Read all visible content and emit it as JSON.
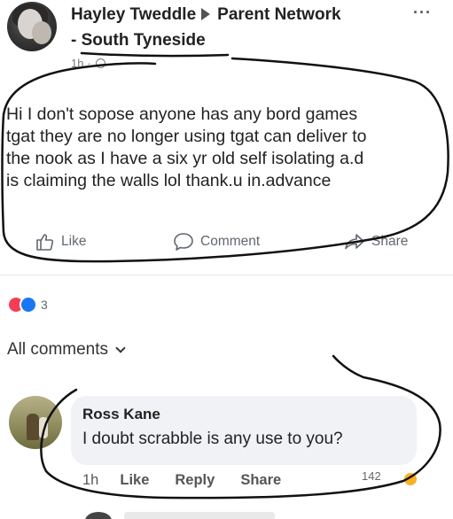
{
  "post": {
    "author": "Hayley Tweddle",
    "group": "Parent Network",
    "group_line2": "- South Tyneside",
    "time": "1h",
    "separator": "·",
    "more": "···",
    "text_lines": [
      "Hi I don't sopose anyone has any bord games",
      "tgat they are no longer using tgat can deliver to",
      "the nook as I have a six yr old self isolating a.d",
      "is claiming the walls lol  thank.u in.advance"
    ]
  },
  "actions": {
    "like": "Like",
    "comment": "Comment",
    "share": "Share"
  },
  "reactions": {
    "count": "3",
    "types": [
      "love-icon",
      "like-icon"
    ]
  },
  "comments_filter": "All comments",
  "comment": {
    "author": "Ross Kane",
    "text": "I doubt scrabble is any use to you?",
    "time": "1h",
    "like": "Like",
    "reply": "Reply",
    "share": "Share",
    "reaction_count": "142"
  },
  "colors": {
    "text": "#1c1e21",
    "muted": "#65676b",
    "like_blue": "#1877f2",
    "love_red": "#f33e58",
    "bubble": "#f0f2f5",
    "ink": "#111111"
  }
}
